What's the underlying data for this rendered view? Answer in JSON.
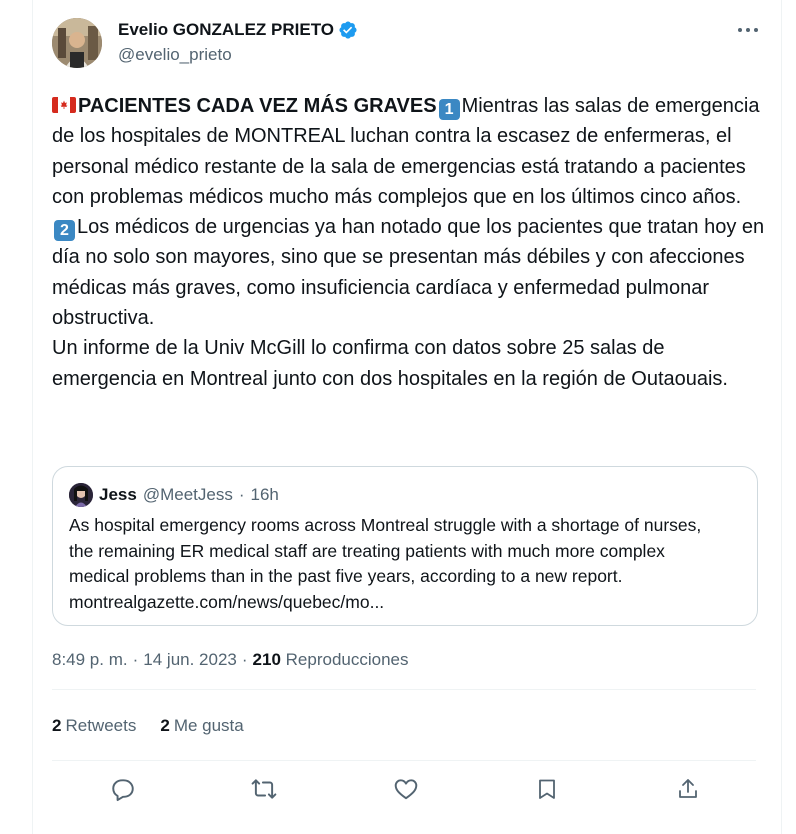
{
  "author": {
    "name": "Evelio GONZALEZ PRIETO",
    "handle": "@evelio_prieto"
  },
  "tweet": {
    "headline": "PACIENTES CADA VEZ MÁS GRAVES",
    "keycap1": "1",
    "part1": "Mientras las salas de emergencia de los hospitales de MONTREAL luchan contra la escasez de enfermeras, el personal médico restante de la sala de emergencias está tratando a pacientes con problemas médicos mucho más complejos que en los últimos cinco años.",
    "keycap2": "2",
    "part2": "Los médicos de urgencias ya han notado que los pacientes que tratan hoy en día no solo son mayores, sino que se presentan más débiles y con afecciones médicas más graves, como insuficiencia cardíaca y enfermedad pulmonar obstructiva.",
    "part3": "Un informe de la Univ McGill lo confirma con datos sobre 25 salas de emergencia en Montreal junto con dos hospitales en la región de Outaouais."
  },
  "quote": {
    "name": "Jess",
    "handle": "@MeetJess",
    "separator": "·",
    "time": "16h",
    "text": "As hospital emergency rooms across Montreal struggle with a shortage of nurses, the remaining ER medical staff are treating patients with much more complex medical problems than in the past five years, according to a new report. montrealgazette.com/news/quebec/mo..."
  },
  "meta": {
    "time": "8:49 p. m.",
    "sep1": "·",
    "date": "14 jun. 2023",
    "sep2": "·",
    "views": "210",
    "views_label": "Reproducciones"
  },
  "stats": {
    "retweets": "2",
    "retweets_label": "Retweets",
    "likes": "2",
    "likes_label": "Me gusta"
  },
  "icons": {
    "verified": "verified-badge-icon",
    "more": "more-icon",
    "reply": "reply-icon",
    "retweet": "retweet-icon",
    "like": "like-icon",
    "bookmark": "bookmark-icon",
    "share": "share-icon"
  },
  "colors": {
    "verified": "#1d9bf0",
    "keycap": "#3b88c3",
    "secondary_text": "#536471",
    "icon": "#536471"
  }
}
